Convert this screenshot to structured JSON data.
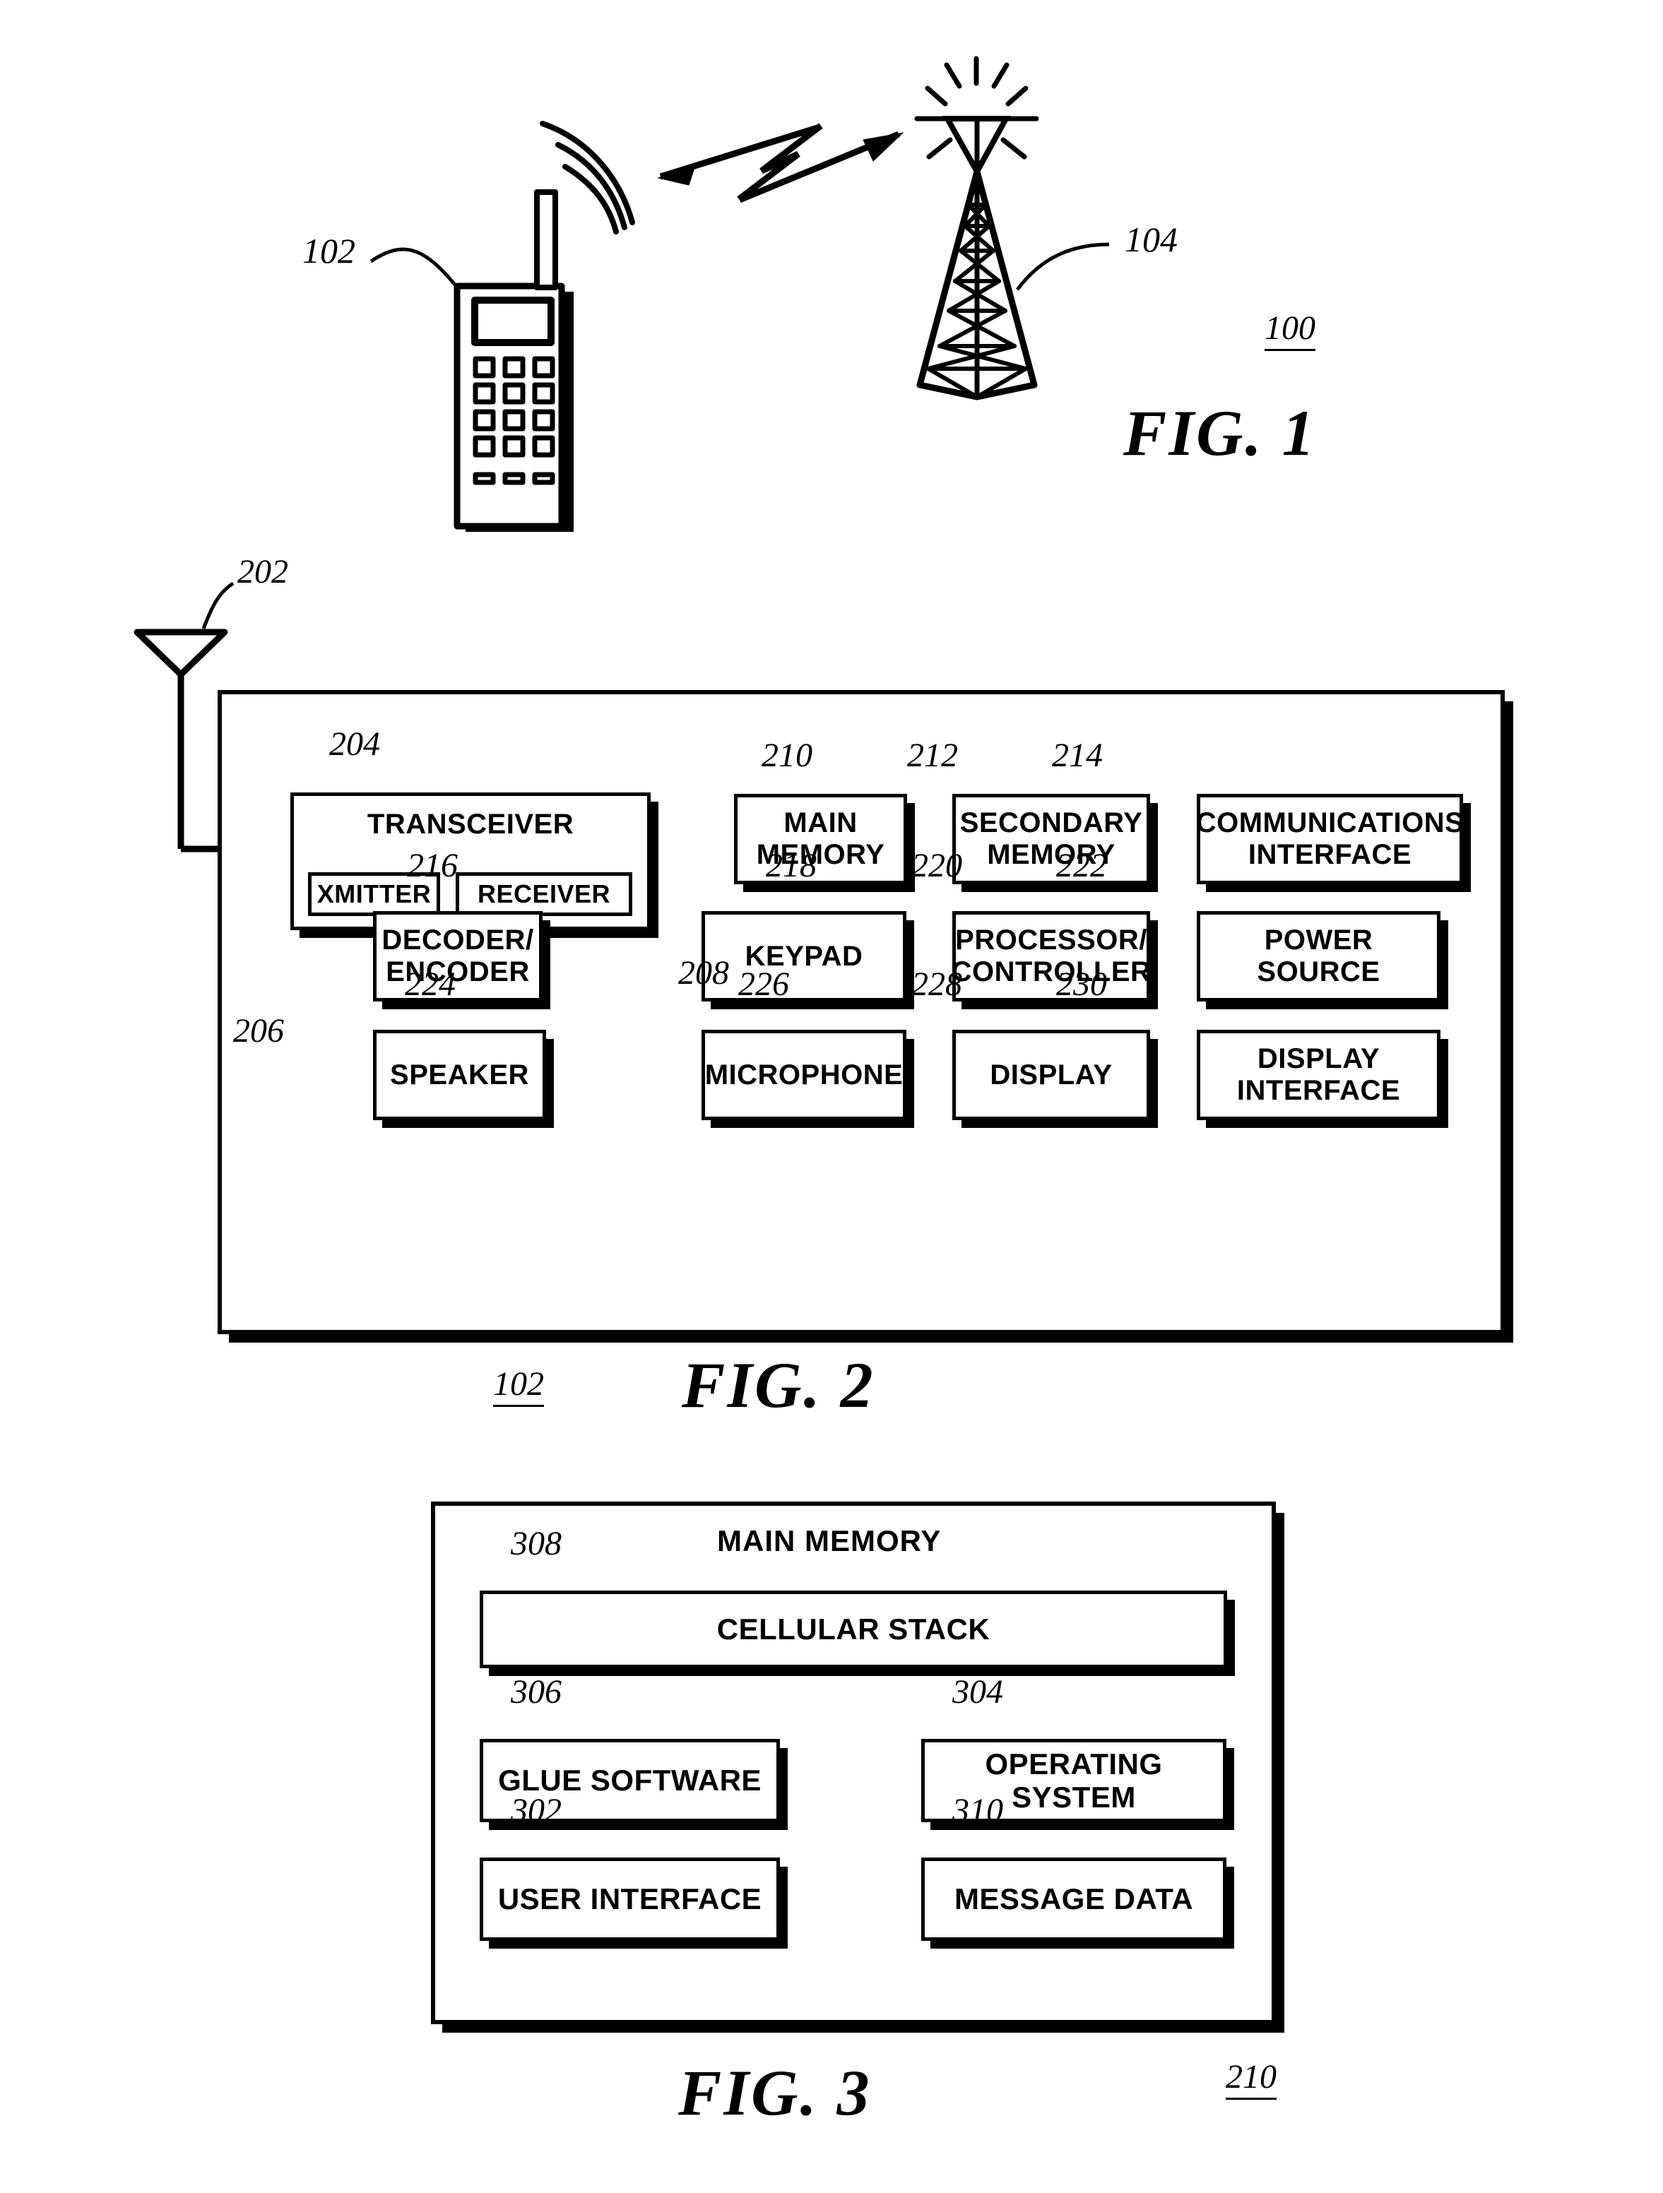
{
  "document": {
    "type": "patent-drawing-sheet",
    "figures": [
      "FIG. 1",
      "FIG. 2",
      "FIG. 3"
    ]
  },
  "fig1": {
    "caption": "FIG. 1",
    "system_ref": "100",
    "phone_ref": "102",
    "tower_ref": "104",
    "elements": {
      "mobile_phone": "cellular-telephone-handset",
      "base_station": "cellular-tower",
      "link": "bidirectional-rf-link"
    }
  },
  "fig2": {
    "caption": "FIG. 2",
    "device_ref": "102",
    "antenna_ref": "202",
    "blocks": [
      {
        "ref": "204",
        "label_lines": [
          "TRANSCEIVER"
        ]
      },
      {
        "ref": "206",
        "label_lines": [
          "XMITTER"
        ]
      },
      {
        "ref": "208",
        "label_lines": [
          "RECEIVER"
        ]
      },
      {
        "ref": "210",
        "label_lines": [
          "MAIN",
          "MEMORY"
        ]
      },
      {
        "ref": "212",
        "label_lines": [
          "SECONDARY",
          "MEMORY"
        ]
      },
      {
        "ref": "214",
        "label_lines": [
          "COMMUNICATIONS",
          "INTERFACE"
        ]
      },
      {
        "ref": "216",
        "label_lines": [
          "DECODER/",
          "ENCODER"
        ]
      },
      {
        "ref": "218",
        "label_lines": [
          "KEYPAD"
        ]
      },
      {
        "ref": "220",
        "label_lines": [
          "PROCESSOR/",
          "CONTROLLER"
        ]
      },
      {
        "ref": "222",
        "label_lines": [
          "POWER SOURCE"
        ]
      },
      {
        "ref": "224",
        "label_lines": [
          "SPEAKER"
        ]
      },
      {
        "ref": "226",
        "label_lines": [
          "MICROPHONE"
        ]
      },
      {
        "ref": "228",
        "label_lines": [
          "DISPLAY"
        ]
      },
      {
        "ref": "230",
        "label_lines": [
          "DISPLAY",
          "INTERFACE"
        ]
      }
    ]
  },
  "fig3": {
    "caption": "FIG. 3",
    "memory_ref": "210",
    "title": "MAIN MEMORY",
    "blocks": [
      {
        "ref": "308",
        "label": "CELLULAR STACK"
      },
      {
        "ref": "306",
        "label": "GLUE SOFTWARE"
      },
      {
        "ref": "304",
        "label": "OPERATING SYSTEM"
      },
      {
        "ref": "302",
        "label": "USER INTERFACE"
      },
      {
        "ref": "310",
        "label": "MESSAGE DATA"
      }
    ]
  },
  "colors": {
    "ink": "#000000",
    "paper": "#ffffff"
  }
}
